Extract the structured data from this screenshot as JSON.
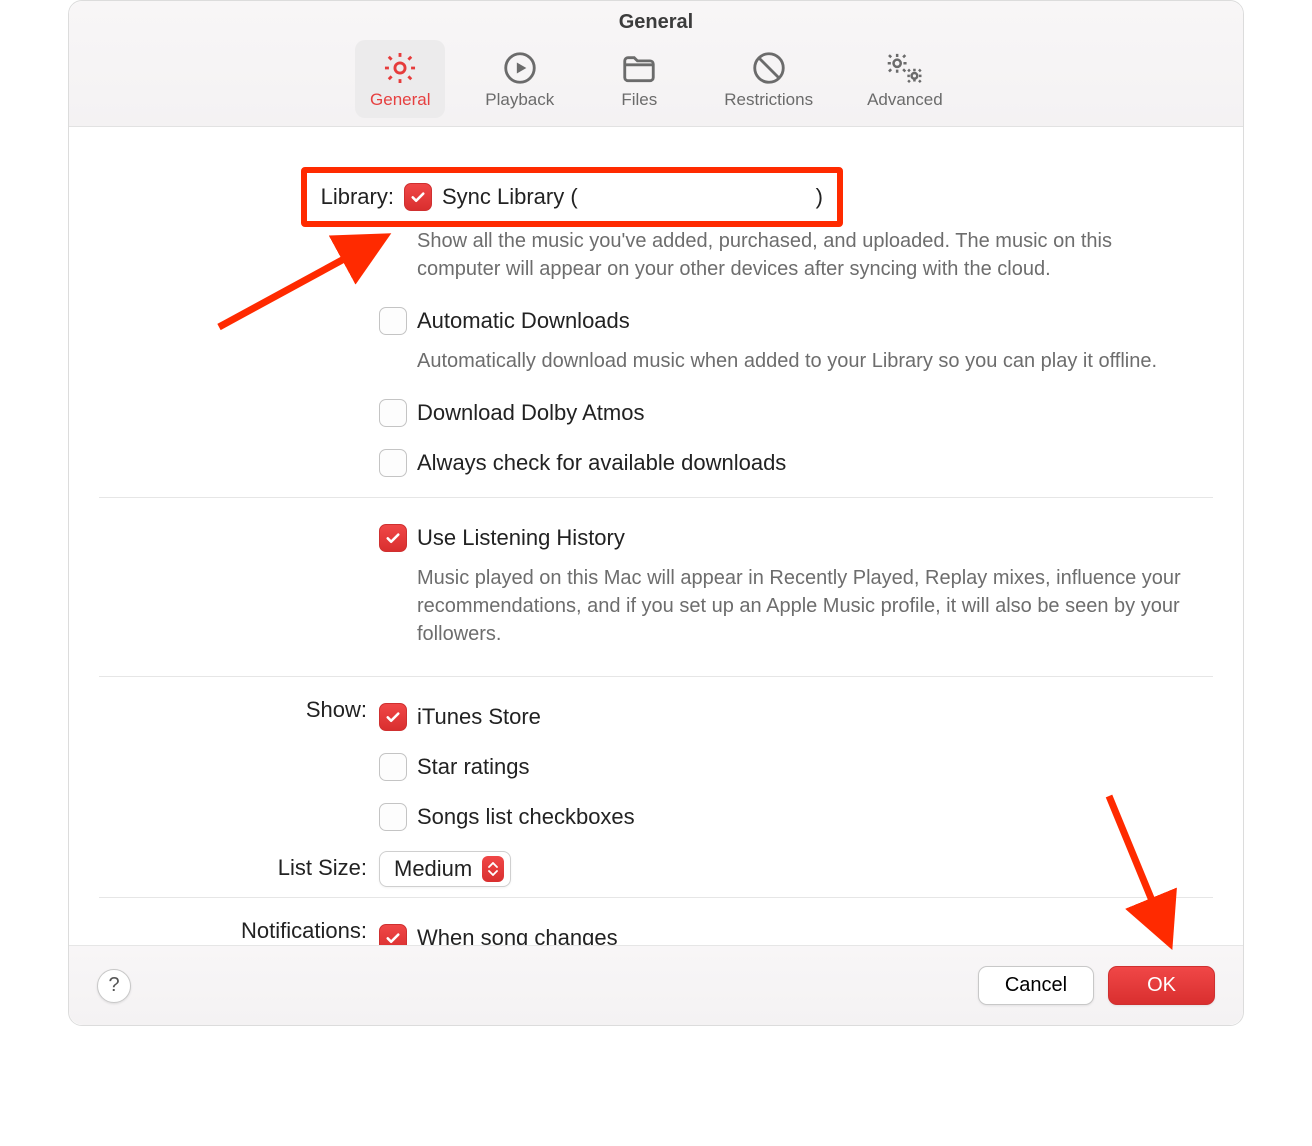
{
  "window": {
    "title": "General"
  },
  "tabs": {
    "general": "General",
    "playback": "Playback",
    "files": "Files",
    "restrictions": "Restrictions",
    "advanced": "Advanced"
  },
  "labels": {
    "library": "Library:",
    "show": "Show:",
    "list_size": "List Size:",
    "notifications": "Notifications:"
  },
  "library": {
    "sync_label_prefix": "Sync Library (",
    "sync_label_suffix": ")",
    "sync_desc": "Show all the music you've added, purchased, and uploaded. The music on this computer will appear on your other devices after syncing with the cloud.",
    "auto_dl": "Automatic Downloads",
    "auto_dl_desc": "Automatically download music when added to your Library so you can play it offline.",
    "dolby": "Download Dolby Atmos",
    "check_dl": "Always check for available downloads"
  },
  "history": {
    "use": "Use Listening History",
    "desc": "Music played on this Mac will appear in Recently Played, Replay mixes, influence your recommendations, and if you set up an Apple Music profile, it will also be seen by your followers."
  },
  "show": {
    "itunes": "iTunes Store",
    "star": "Star ratings",
    "checkboxes": "Songs list checkboxes"
  },
  "list_size": {
    "value": "Medium"
  },
  "notifications": {
    "song_change": "When song changes"
  },
  "buttons": {
    "help": "?",
    "cancel": "Cancel",
    "ok": "OK"
  },
  "colors": {
    "accent": "#e63b3b",
    "annotation": "#ff2a00"
  }
}
